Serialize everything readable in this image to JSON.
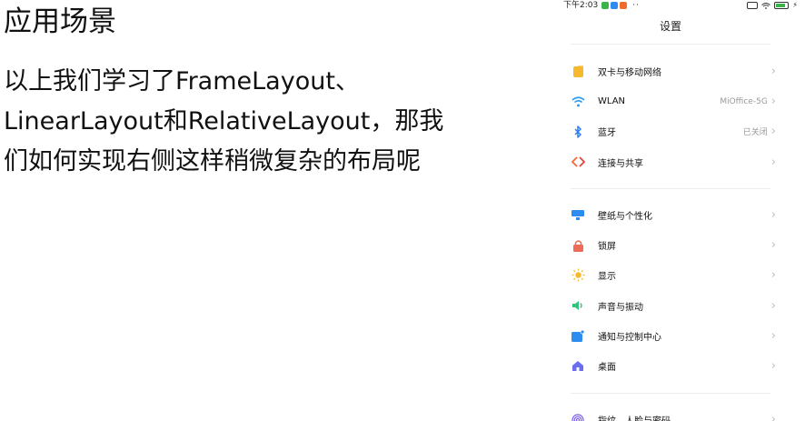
{
  "slide": {
    "title": "应用场景",
    "body_lines": [
      "以上我们学习了FrameLayout、",
      "LinearLayout和RelativeLayout，那我",
      "们如何实现右侧这样稍微复杂的布局呢"
    ]
  },
  "phone": {
    "status": {
      "time": "下午2:03",
      "dots": "··"
    },
    "title": "设置",
    "groups": [
      [
        {
          "label": "双卡与移动网络",
          "value": "",
          "icon": "sim-card-icon",
          "color": "#f5b82e"
        },
        {
          "label": "WLAN",
          "value": "MiOffice-5G",
          "icon": "wifi-icon",
          "color": "#2d9cf0"
        },
        {
          "label": "蓝牙",
          "value": "已关闭",
          "icon": "bluetooth-icon",
          "color": "#2d7ff0"
        },
        {
          "label": "连接与共享",
          "value": "",
          "icon": "share-connect-icon",
          "color": "#f0683c"
        }
      ],
      [
        {
          "label": "壁纸与个性化",
          "value": "",
          "icon": "wallpaper-icon",
          "color": "#2d8cf0"
        },
        {
          "label": "锁屏",
          "value": "",
          "icon": "lock-screen-icon",
          "color": "#f06a5a"
        },
        {
          "label": "显示",
          "value": "",
          "icon": "display-sun-icon",
          "color": "#f5b82e"
        },
        {
          "label": "声音与振动",
          "value": "",
          "icon": "sound-icon",
          "color": "#35c27a"
        },
        {
          "label": "通知与控制中心",
          "value": "",
          "icon": "notification-icon",
          "color": "#2d8cf0"
        },
        {
          "label": "桌面",
          "value": "",
          "icon": "home-desktop-icon",
          "color": "#6b6ef0"
        }
      ],
      [
        {
          "label": "指纹、人脸与密码",
          "value": "",
          "icon": "fingerprint-icon",
          "color": "#7a5af0"
        }
      ]
    ]
  }
}
